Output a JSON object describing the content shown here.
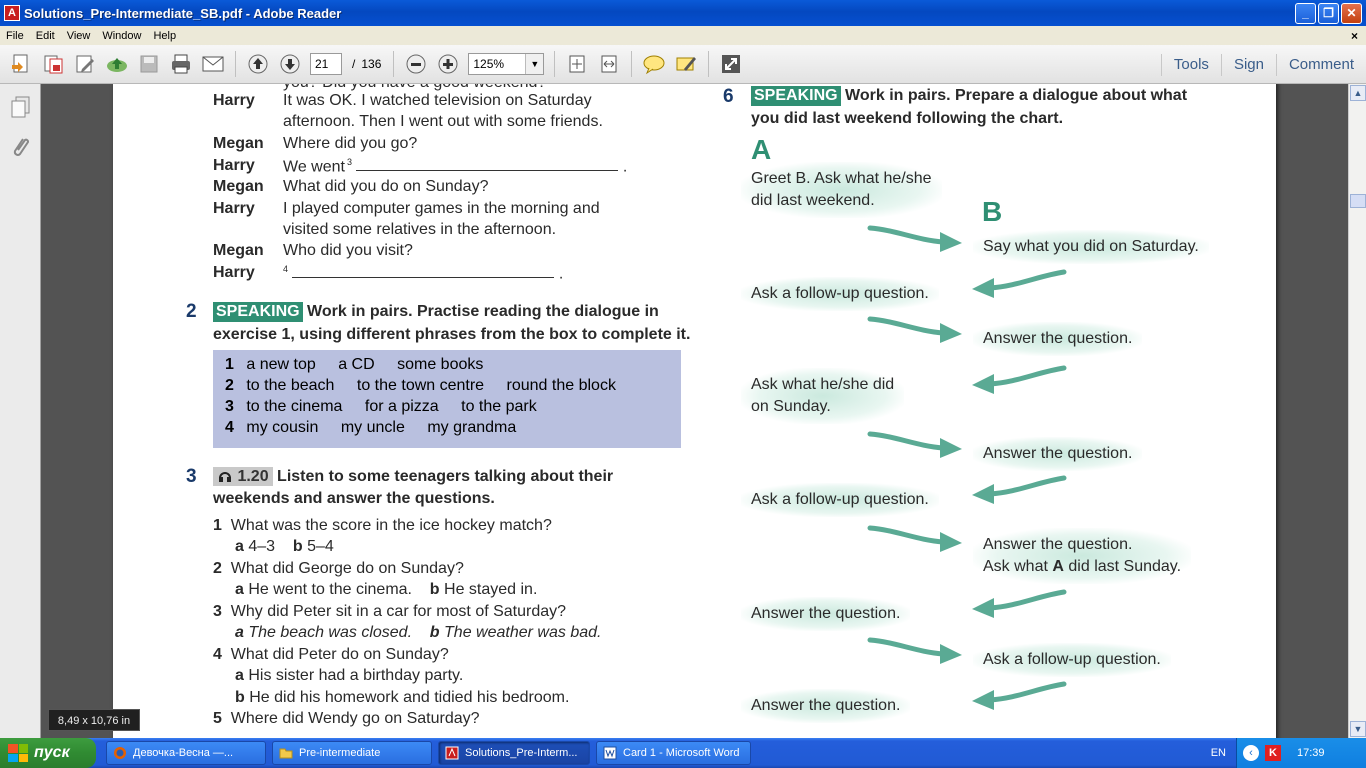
{
  "window": {
    "title": "Solutions_Pre-Intermediate_SB.pdf - Adobe Reader",
    "app_icon_glyph": "⅄"
  },
  "menu": [
    "File",
    "Edit",
    "View",
    "Window",
    "Help"
  ],
  "toolbar": {
    "page_current": "21",
    "page_separator": "/",
    "page_total": "136",
    "zoom": "125%",
    "right_links": [
      "Tools",
      "Sign",
      "Comment"
    ]
  },
  "doc": {
    "left": {
      "top_cut": "you? Did you have a good weekend?",
      "dialogue": [
        {
          "speaker": "Harry",
          "line": "It was OK. I watched television on Saturday"
        },
        {
          "speaker": "",
          "line": "afternoon. Then I went out with some friends."
        },
        {
          "speaker": "Megan",
          "line": "Where did you go?"
        },
        {
          "speaker": "Harry",
          "line": "We went"
        },
        {
          "speaker": "Megan",
          "line": "What did you do on Sunday?"
        },
        {
          "speaker": "Harry",
          "line": "I played computer games in the morning and"
        },
        {
          "speaker": "",
          "line": "visited some relatives in the afternoon."
        },
        {
          "speaker": "Megan",
          "line": "Who did you visit?"
        },
        {
          "speaker": "Harry",
          "line": ""
        }
      ],
      "blank3_num": "3",
      "blank4_num": "4",
      "ex2": {
        "num": "2",
        "tag": "SPEAKING",
        "line1": "Work in pairs. Practise reading the dialogue in",
        "line2": "exercise 1, using different phrases from the box to complete it."
      },
      "box_rows": [
        {
          "n": "1",
          "items": [
            "a new top",
            "a CD",
            "some books"
          ]
        },
        {
          "n": "2",
          "items": [
            "to the beach",
            "to the town centre",
            "round the block"
          ]
        },
        {
          "n": "3",
          "items": [
            "to the cinema",
            "for a pizza",
            "to the park"
          ]
        },
        {
          "n": "4",
          "items": [
            "my cousin",
            "my uncle",
            "my grandma"
          ]
        }
      ],
      "ex3": {
        "num": "3",
        "audio": "1.20",
        "line1": "Listen to some teenagers talking about their",
        "line2": "weekends and answer the questions."
      },
      "questions": [
        {
          "n": "1",
          "q": "What was the score in the ice hockey match?",
          "a": "4–3",
          "b": "5–4"
        },
        {
          "n": "2",
          "q": "What did George do on Sunday?",
          "a": "He went to the cinema.",
          "b": "He stayed in."
        },
        {
          "n": "3",
          "q": "Why did Peter sit in a car for most of Saturday?",
          "a": "The beach was closed.",
          "b": "The weather was bad."
        },
        {
          "n": "4",
          "q": "What did Peter do on Sunday?",
          "a": "His sister had a birthday party.",
          "b": "He did his homework and tidied his bedroom."
        },
        {
          "n": "5",
          "q": "Where did Wendy go on Saturday?",
          "a": "",
          "b": ""
        }
      ]
    },
    "right": {
      "ex6": {
        "num": "6",
        "tag": "SPEAKING",
        "line1": "Work in pairs. Prepare a dialogue about what",
        "line2": "you did last weekend following the chart."
      },
      "letter_a": "A",
      "letter_b": "B",
      "a_items": [
        "Greet B. Ask what he/she",
        "did last weekend.",
        "Ask a follow-up question.",
        "Ask what he/she did",
        "on Sunday.",
        "Ask a follow-up question.",
        "Answer the question.",
        "Answer the question."
      ],
      "b_items": [
        "Say what you did on Saturday.",
        "Answer the question.",
        "Answer the question.",
        "Answer the question.",
        "Ask what A did last Sunday.",
        "Ask a follow-up question."
      ],
      "ask_prefix": "Ask what",
      "ask_bold": "A",
      "ask_suffix": "did last Sunday."
    }
  },
  "page_size_tip": "8,49 x 10,76 in",
  "taskbar": {
    "start": "пуск",
    "tasks": [
      "Девочка-Весна —...",
      "Pre-intermediate",
      "Solutions_Pre-Interm...",
      "Card 1 - Microsoft Word"
    ],
    "lang": "EN",
    "clock": "17:39"
  },
  "colors": {
    "speaking_green": "#2f8f73",
    "box_lavender": "#b9c0df",
    "title_blue": "#0a5ad8",
    "taskbar_blue": "#245edb",
    "start_green": "#308b32"
  }
}
